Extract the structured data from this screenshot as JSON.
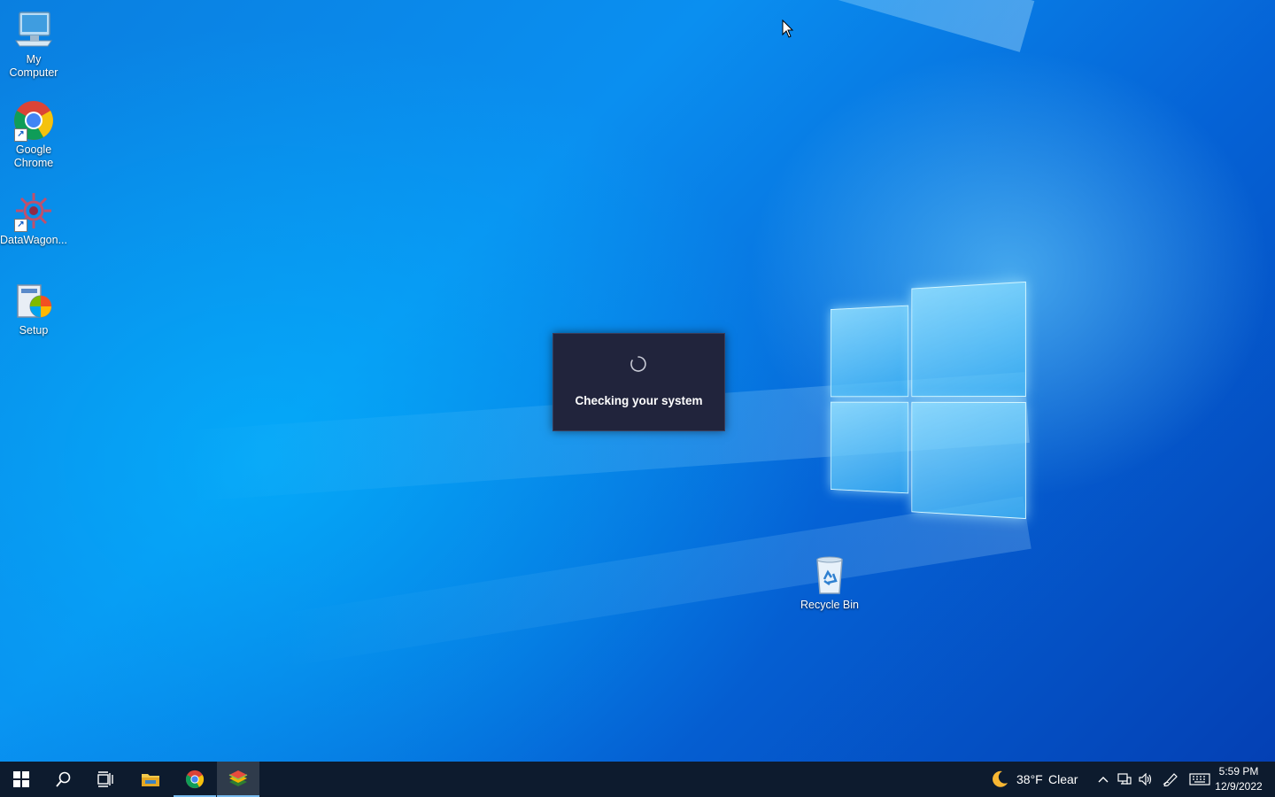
{
  "desktop": {
    "icons": [
      {
        "label": "My\nComputer",
        "icon": "computer-icon"
      },
      {
        "label": "Google\nChrome",
        "icon": "chrome-icon"
      },
      {
        "label": "DataWagon...",
        "icon": "datawagon-icon"
      },
      {
        "label": "Setup",
        "icon": "setup-installer-icon"
      },
      {
        "label": "Recycle Bin",
        "icon": "recycle-bin-icon"
      }
    ],
    "wallpaper": "windows-10-hero",
    "colors": {
      "accent": "#0a7fe0",
      "dark": "#0440b4"
    }
  },
  "dialog": {
    "message": "Checking your system",
    "spinner": "loading-spinner-icon",
    "background": "#21243c"
  },
  "taskbar": {
    "buttons": [
      {
        "name": "start",
        "icon": "windows-start-icon"
      },
      {
        "name": "search",
        "icon": "search-icon"
      },
      {
        "name": "task-view",
        "icon": "task-view-icon"
      },
      {
        "name": "file-explorer",
        "icon": "folder-icon"
      },
      {
        "name": "chrome",
        "icon": "chrome-icon"
      },
      {
        "name": "app",
        "icon": "bluestacks-icon"
      }
    ],
    "weather": {
      "temp": "38°F",
      "condition": "Clear",
      "icon": "moon-icon"
    },
    "tray_icons": [
      "chevron-up-icon",
      "network-icon",
      "volume-icon",
      "pen-icon",
      "keyboard-icon"
    ],
    "clock": {
      "time": "5:59 PM",
      "date": "12/9/2022"
    },
    "background": "#0d1b2e"
  }
}
